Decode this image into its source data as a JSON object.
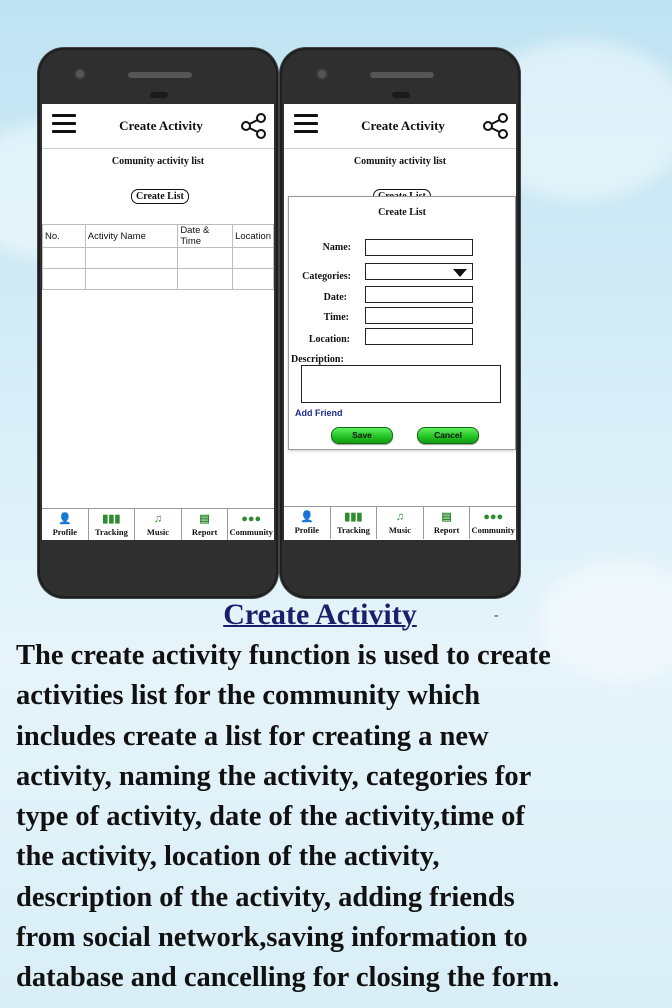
{
  "left_phone": {
    "appbar": {
      "title": "Create Activity"
    },
    "subtitle": "Comunity activity  list",
    "create_list_button": "Create List",
    "table": {
      "headers": [
        "No.",
        "Activity Name",
        "Date & Time",
        "Location"
      ],
      "rows": [
        [
          "",
          "",
          "",
          ""
        ],
        [
          "",
          "",
          "",
          ""
        ]
      ]
    },
    "nav": [
      {
        "label": "Profile",
        "icon": "person-icon"
      },
      {
        "label": "Tracking",
        "icon": "bar-chart-icon"
      },
      {
        "label": "Music",
        "icon": "music-note-icon"
      },
      {
        "label": "Report",
        "icon": "report-icon"
      },
      {
        "label": "Community",
        "icon": "group-icon"
      }
    ]
  },
  "right_phone": {
    "appbar": {
      "title": "Create Activity"
    },
    "subtitle": "Comunity activity  list",
    "create_list_button": "Create List",
    "dialog": {
      "title": "Create List",
      "fields": {
        "name": "Name:",
        "categories": "Categories:",
        "date": "Date:",
        "time": "Time:",
        "location": "Location:",
        "description": "Description:"
      },
      "add_friend": "Add Friend",
      "save": "Save",
      "cancel": "Cancel"
    },
    "nav": [
      {
        "label": "Profile",
        "icon": "person-icon"
      },
      {
        "label": "Tracking",
        "icon": "bar-chart-icon"
      },
      {
        "label": "Music",
        "icon": "music-note-icon"
      },
      {
        "label": "Report",
        "icon": "report-icon"
      },
      {
        "label": "Community",
        "icon": "group-icon"
      }
    ]
  },
  "caption": {
    "heading": "Create Activity",
    "dash": "-",
    "body": "The create activity function is used to create\nactivities list for the community which\nincludes create a list for creating a new\nactivity,  naming the activity, categories for\ntype of activity, date of the activity,time of\nthe activity, location of the activity,\ndescription of the activity, adding friends\nfrom social network,saving information to\ndatabase and cancelling for closing the form."
  },
  "colors": {
    "heading": "#1b1f6b",
    "button_green": "#21c121",
    "add_friend": "#1a2a8a",
    "nav_icon": "#2e8b2e"
  }
}
